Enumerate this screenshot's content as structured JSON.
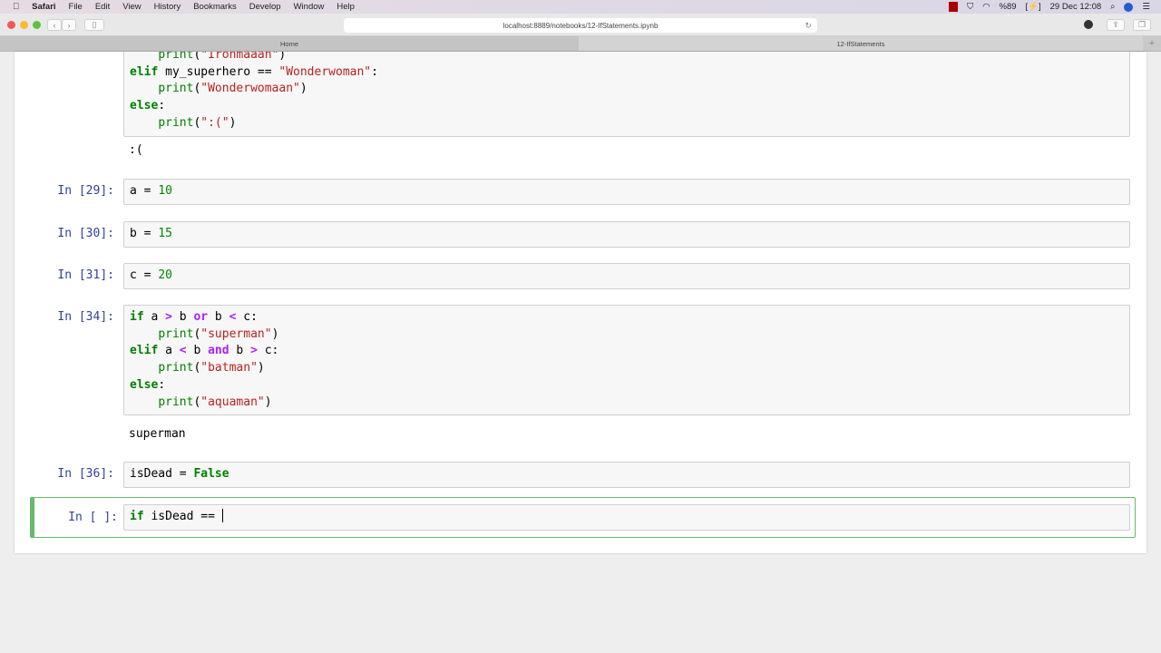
{
  "menubar": {
    "apple": "",
    "items": [
      "Safari",
      "File",
      "Edit",
      "View",
      "History",
      "Bookmarks",
      "Develop",
      "Window",
      "Help"
    ],
    "battery": "%89",
    "datetime": "29 Dec 12:08"
  },
  "browser": {
    "url": "localhost:8889/notebooks/12-IfStatements.ipynb",
    "tabs": [
      "Home",
      "12-IfStatements"
    ]
  },
  "cells": [
    {
      "prompt": "",
      "lines": [
        [
          [
            "    ",
            ""
          ],
          [
            "print",
            "bi"
          ],
          [
            "(\"",
            ""
          ],
          [
            "Ironmaaan",
            "str"
          ],
          [
            "\")",
            ""
          ]
        ],
        [
          [
            "elif",
            "kw"
          ],
          [
            " my_superhero == ",
            ""
          ],
          [
            "\"Wonderwoman\"",
            "str"
          ],
          [
            ":",
            ""
          ]
        ],
        [
          [
            "    ",
            ""
          ],
          [
            "print",
            "bi"
          ],
          [
            "(",
            ""
          ],
          [
            "\"Wonderwomaan\"",
            "str"
          ],
          [
            ")",
            ""
          ]
        ],
        [
          [
            "else",
            "kw"
          ],
          [
            ":",
            ""
          ]
        ],
        [
          [
            "    ",
            ""
          ],
          [
            "print",
            "bi"
          ],
          [
            "(",
            ""
          ],
          [
            "\":(\"",
            "str"
          ],
          [
            ")",
            ""
          ]
        ]
      ],
      "output": ":("
    },
    {
      "prompt": "In [29]:",
      "lines": [
        [
          [
            "a = ",
            ""
          ],
          [
            "10",
            "num"
          ]
        ]
      ]
    },
    {
      "prompt": "In [30]:",
      "lines": [
        [
          [
            "b = ",
            ""
          ],
          [
            "15",
            "num"
          ]
        ]
      ]
    },
    {
      "prompt": "In [31]:",
      "lines": [
        [
          [
            "c = ",
            ""
          ],
          [
            "20",
            "num"
          ]
        ]
      ]
    },
    {
      "prompt": "In [34]:",
      "lines": [
        [
          [
            "if",
            "kw"
          ],
          [
            " a ",
            ""
          ],
          [
            ">",
            "op"
          ],
          [
            " b ",
            ""
          ],
          [
            "or",
            "op"
          ],
          [
            " b ",
            ""
          ],
          [
            "<",
            "op"
          ],
          [
            " c:",
            ""
          ]
        ],
        [
          [
            "    ",
            ""
          ],
          [
            "print",
            "bi"
          ],
          [
            "(",
            ""
          ],
          [
            "\"superman\"",
            "str"
          ],
          [
            ")",
            ""
          ]
        ],
        [
          [
            "elif",
            "kw"
          ],
          [
            " a ",
            ""
          ],
          [
            "<",
            "op"
          ],
          [
            " b ",
            ""
          ],
          [
            "and",
            "op"
          ],
          [
            " b ",
            ""
          ],
          [
            ">",
            "op"
          ],
          [
            " c:",
            ""
          ]
        ],
        [
          [
            "    ",
            ""
          ],
          [
            "print",
            "bi"
          ],
          [
            "(",
            ""
          ],
          [
            "\"batman\"",
            "str"
          ],
          [
            ")",
            ""
          ]
        ],
        [
          [
            "else",
            "kw"
          ],
          [
            ":",
            ""
          ]
        ],
        [
          [
            "    ",
            ""
          ],
          [
            "print",
            "bi"
          ],
          [
            "(",
            ""
          ],
          [
            "\"aquaman\"",
            "str"
          ],
          [
            ")",
            ""
          ]
        ]
      ],
      "output": "superman"
    },
    {
      "prompt": "In [36]:",
      "lines": [
        [
          [
            "isDead = ",
            ""
          ],
          [
            "False",
            "kw"
          ]
        ]
      ]
    },
    {
      "prompt": "In [ ]:",
      "lines": [
        [
          [
            "if",
            "kw"
          ],
          [
            " isDead == ",
            ""
          ]
        ]
      ]
    }
  ]
}
